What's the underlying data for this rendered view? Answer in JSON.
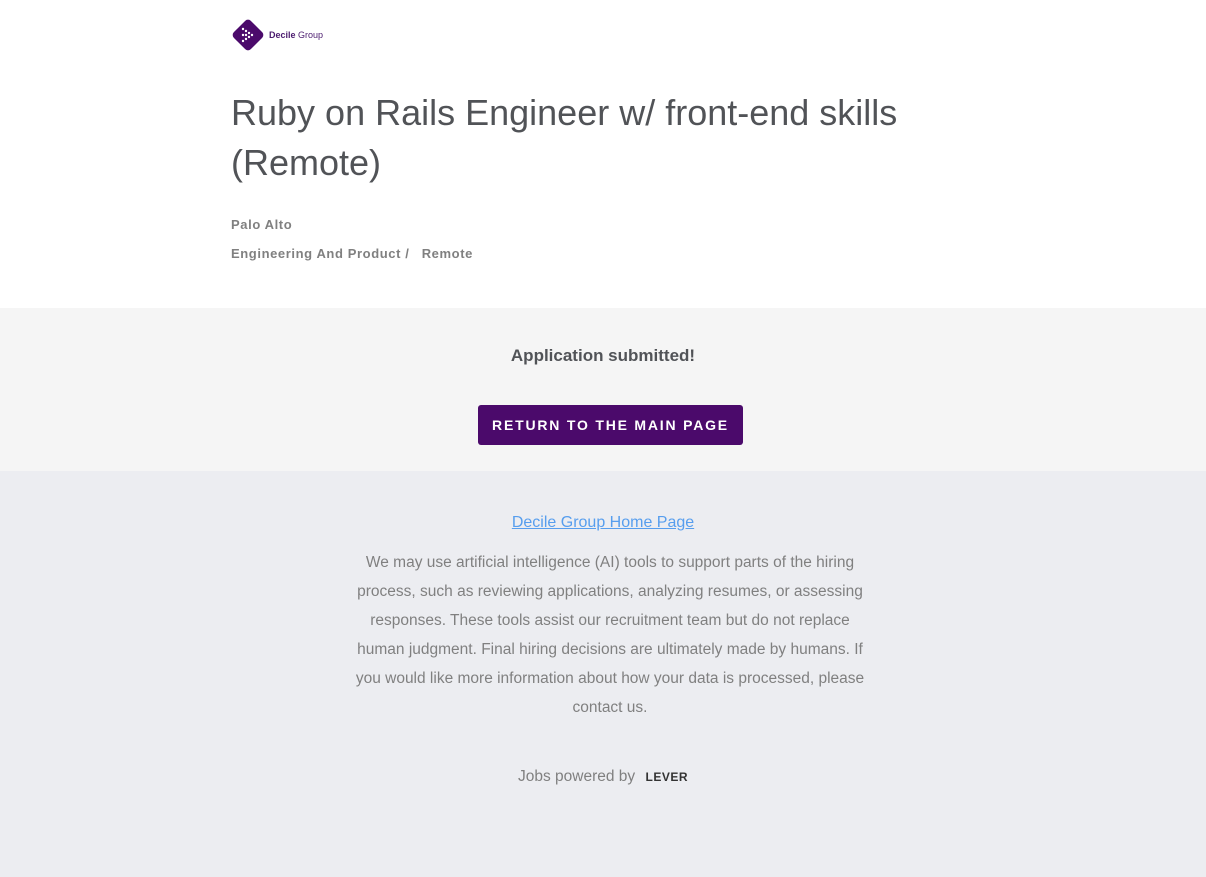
{
  "brand": {
    "name": "Decile",
    "name_suffix": "Group",
    "accent_color": "#4b0a6b"
  },
  "job": {
    "title": "Ruby on Rails Engineer w/ front-end skills (Remote)",
    "location": "Palo Alto",
    "team": "Engineering And Product /",
    "commitment": "Remote"
  },
  "confirmation": {
    "message": "Application submitted!",
    "return_button_label": "RETURN TO THE MAIN PAGE"
  },
  "footer": {
    "home_link_label": "Decile Group Home Page",
    "ai_notice": "We may use artificial intelligence (AI) tools to support parts of the hiring process, such as reviewing applications, analyzing resumes, or assessing responses. These tools assist our recruitment team but do not replace human judgment. Final hiring decisions are ultimately made by humans. If you would like more information about how your data is processed, please contact us.",
    "powered_by_label": "Jobs powered by",
    "powered_by_brand": "LEVER",
    "link_color": "#579eee"
  }
}
